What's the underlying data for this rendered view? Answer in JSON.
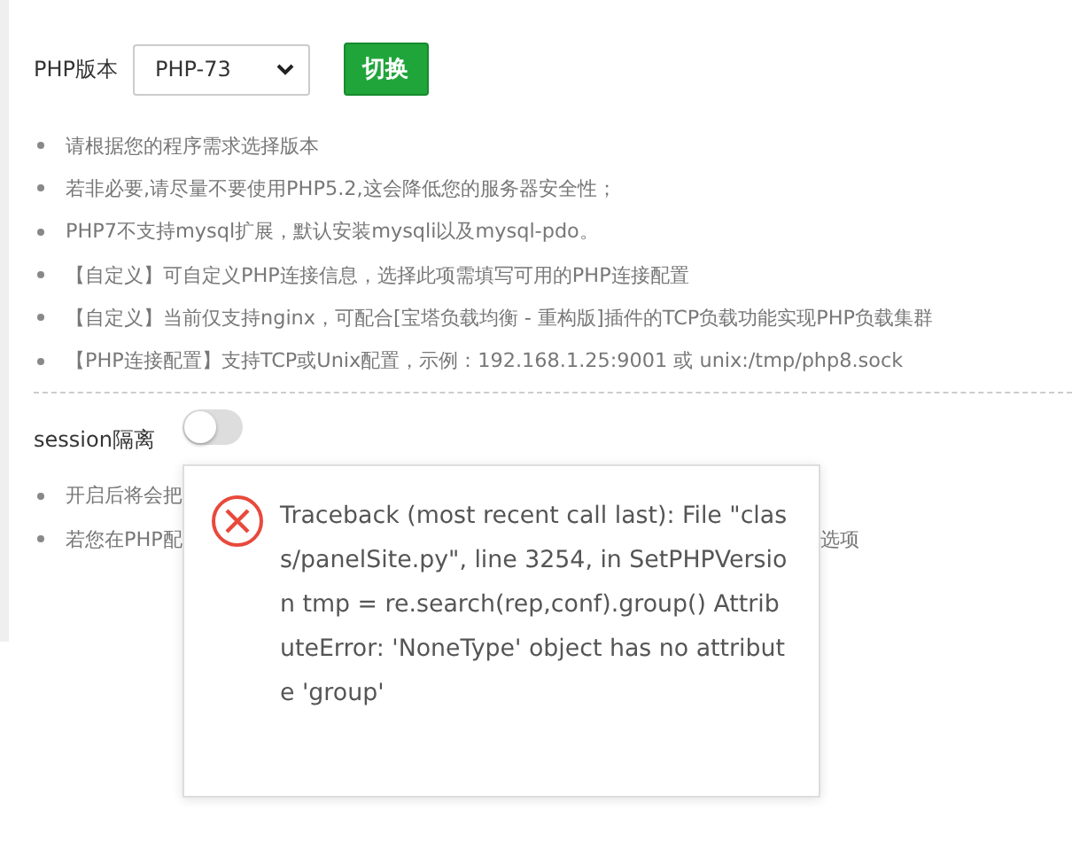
{
  "php_version": {
    "label": "PHP版本",
    "select_value": "PHP-73",
    "button": "切换"
  },
  "notes": [
    "请根据您的程序需求选择版本",
    "若非必要,请尽量不要使用PHP5.2,这会降低您的服务器安全性；",
    "PHP7不支持mysql扩展，默认安装mysqli以及mysql-pdo。",
    "【自定义】可自定义PHP连接信息，选择此项需填写可用的PHP连接配置",
    "【自定义】当前仅支持nginx，可配合[宝塔负载均衡 - 重构版]插件的TCP负载功能实现PHP负载集群",
    "【PHP连接配置】支持TCP或Unix配置，示例：192.168.1.25:9001 或 unix:/tmp/php8.sock"
  ],
  "session": {
    "label": "session隔离",
    "on": false
  },
  "session_notes": [
    {
      "left": "开启后将会把"
    },
    {
      "left": "若您在PHP配",
      "right": "选项"
    }
  ],
  "error_toast": {
    "message": "Traceback (most recent call last): File \"class/panelSite.py\", line 3254, in SetPHPVersion tmp = re.search(rep,conf).group() AttributeError: 'NoneType' object has no attribute 'group'"
  }
}
